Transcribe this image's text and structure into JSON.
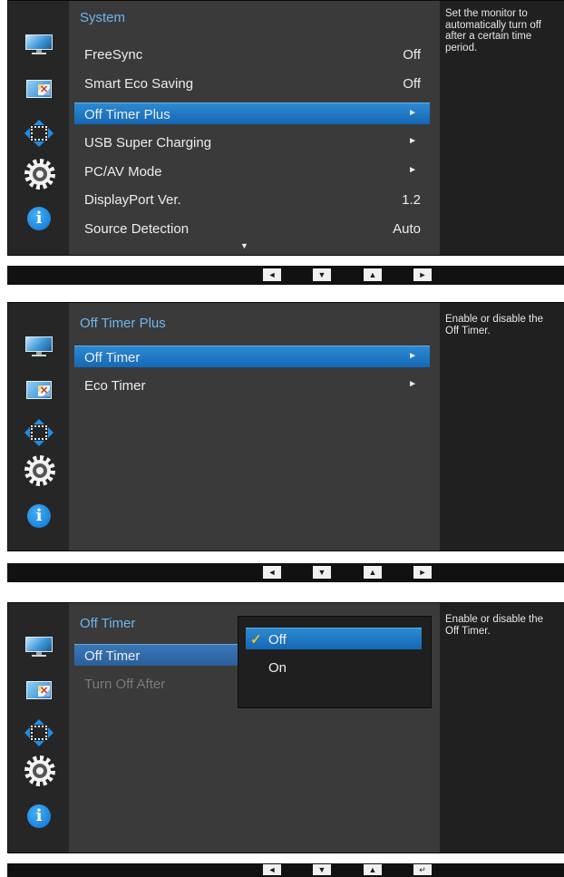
{
  "panel1": {
    "title": "System",
    "help": "Set the monitor to automatically turn off after a certain time period.",
    "items": [
      {
        "label": "FreeSync",
        "value": "Off",
        "arrow": ""
      },
      {
        "label": "Smart Eco Saving",
        "value": "Off",
        "arrow": ""
      },
      {
        "label": "Off Timer Plus",
        "value": "",
        "arrow": "►"
      },
      {
        "label": "USB Super Charging",
        "value": "",
        "arrow": "►"
      },
      {
        "label": "PC/AV Mode",
        "value": "",
        "arrow": "►"
      },
      {
        "label": "DisplayPort Ver.",
        "value": "1.2",
        "arrow": ""
      },
      {
        "label": "Source Detection",
        "value": "Auto",
        "arrow": ""
      }
    ],
    "more": "▼"
  },
  "panel2": {
    "title": "Off Timer Plus",
    "help": "Enable or disable the Off Timer.",
    "items": [
      {
        "label": "Off Timer",
        "arrow": "►"
      },
      {
        "label": "Eco Timer",
        "arrow": "►"
      }
    ]
  },
  "panel3": {
    "title": "Off Timer",
    "help": "Enable or disable the Off Timer.",
    "items": [
      {
        "label": "Off Timer"
      },
      {
        "label": "Turn Off After"
      }
    ],
    "popup": {
      "check": "✓",
      "options": [
        "Off",
        "On"
      ]
    }
  },
  "keys": {
    "left": "◄",
    "down": "▼",
    "up": "▲",
    "right": "►",
    "enter": "↵"
  },
  "sidebar_icons": [
    "picture-icon",
    "color-icon",
    "screen-adjust-icon",
    "system-icon",
    "information-icon"
  ],
  "colors": {
    "accent": "#1a78c4",
    "title": "#6fb5ee",
    "check": "#f2c21a"
  }
}
